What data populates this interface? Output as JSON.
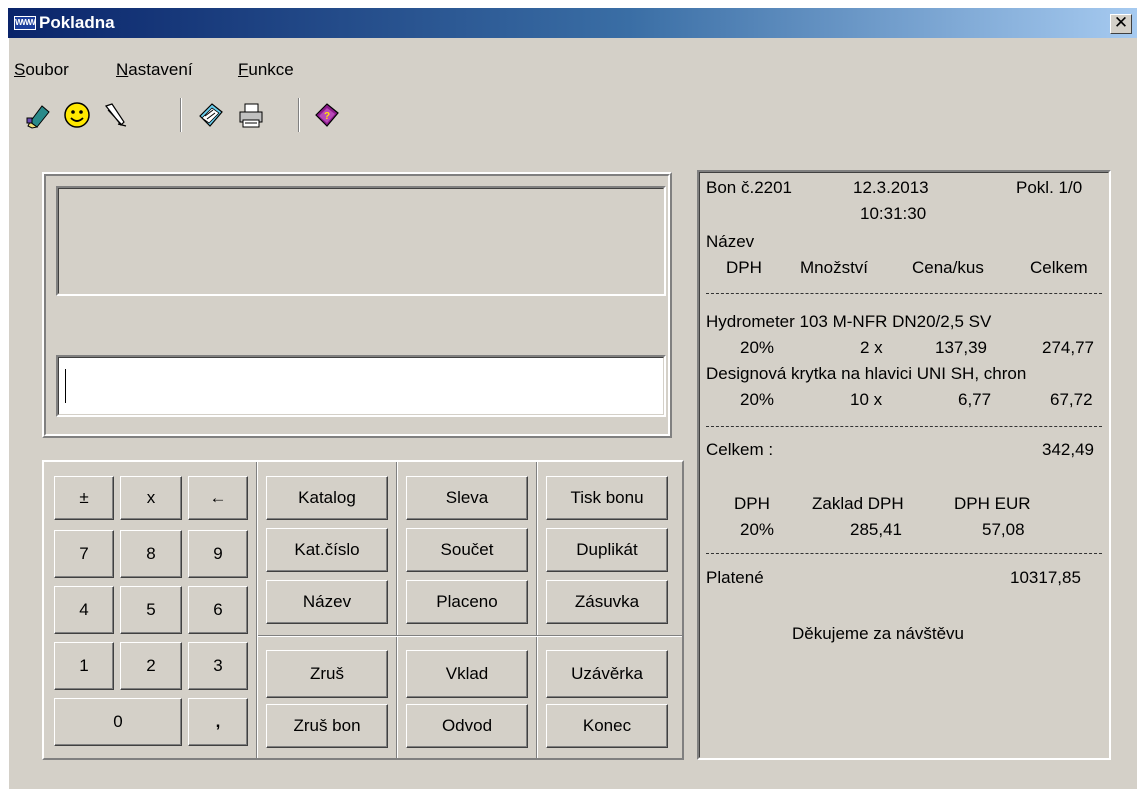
{
  "window": {
    "title": "Pokladna",
    "close_glyph": "✕",
    "app_icon_text": "WWW"
  },
  "menu": {
    "items": [
      {
        "accel": "S",
        "rest": "oubor"
      },
      {
        "accel": "N",
        "rest": "astavení"
      },
      {
        "accel": "F",
        "rest": "unkce"
      }
    ]
  },
  "toolbar": {
    "icons": [
      "pencil-eraser-icon",
      "smiley-icon",
      "pen-edit-icon",
      "notebook-icon",
      "printer-icon",
      "help-book-icon"
    ]
  },
  "keypad": {
    "numeric": [
      "±",
      "x",
      "←",
      "7",
      "8",
      "9",
      "4",
      "5",
      "6",
      "1",
      "2",
      "3",
      "0",
      ","
    ],
    "col1": [
      "Katalog",
      "Kat.číslo",
      "Název",
      "Zruš",
      "Zruš bon"
    ],
    "col2": [
      "Sleva",
      "Součet",
      "Placeno",
      "Vklad",
      "Odvod"
    ],
    "col3": [
      "Tisk bonu",
      "Duplikát",
      "Zásuvka",
      "Uzávěrka",
      "Konec"
    ]
  },
  "receipt": {
    "bon": "Bon č.2201",
    "date": "12.3.2013",
    "pokl": "Pokl. 1/0",
    "time": "10:31:30",
    "header_name": "Název",
    "header_dph": "DPH",
    "header_qty": "Množství",
    "header_price": "Cena/kus",
    "header_total": "Celkem",
    "items": [
      {
        "name": "Hydrometer 103 M-NFR DN20/2,5 SV",
        "vat": "20%",
        "qty": "2 x",
        "price": "137,39",
        "total": "274,77"
      },
      {
        "name": "Designová krytka na hlavici UNI SH, chron",
        "vat": "20%",
        "qty": "10 x",
        "price": "6,77",
        "total": "67,72"
      }
    ],
    "sum_label": "Celkem :",
    "sum_value": "342,49",
    "vat_h1": "DPH",
    "vat_h2": "Zaklad DPH",
    "vat_h3": "DPH EUR",
    "vat_rate": "20%",
    "vat_base": "285,41",
    "vat_amount": "57,08",
    "paid_label": "Platené",
    "paid_value": "10317,85",
    "thanks": "Děkujeme za návštěvu"
  }
}
